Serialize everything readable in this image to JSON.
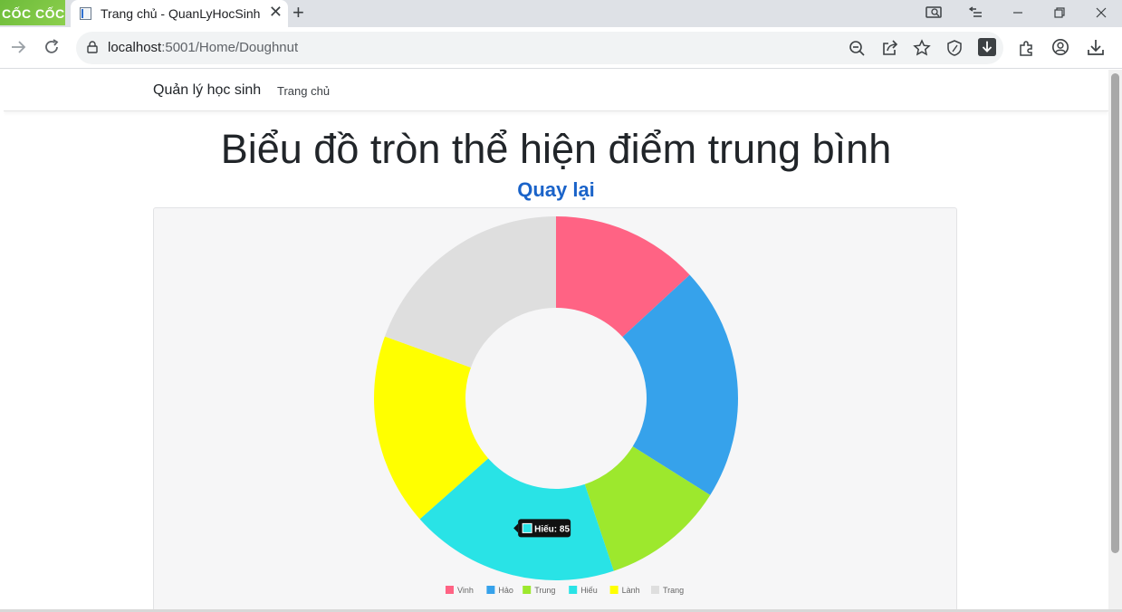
{
  "browser": {
    "brand": "CỐC CỐC",
    "tab_title": "Trang chủ - QuanLyHocSinh",
    "url_host": "localhost",
    "url_rest": ":5001/Home/Doughnut"
  },
  "navbar": {
    "brand": "Quản lý học sinh",
    "links": [
      "Trang chủ"
    ]
  },
  "page": {
    "heading": "Biểu đồ tròn thể hiện điểm trung bình",
    "back_link": "Quay lại"
  },
  "colors": {
    "accent": "#1a63c9"
  },
  "chart_data": {
    "type": "doughnut",
    "categories": [
      "Vinh",
      "Hảo",
      "Trung",
      "Hiếu",
      "Lành",
      "Trang"
    ],
    "values": [
      60,
      95,
      50,
      85,
      78,
      89
    ],
    "colors": [
      "#ff6384",
      "#36a2eb",
      "#9de82d",
      "#29e3e6",
      "#ffff00",
      "#dedede"
    ],
    "legend": "bottom",
    "tooltip": {
      "text": "Hiếu: 85",
      "category": "Hiếu"
    }
  }
}
